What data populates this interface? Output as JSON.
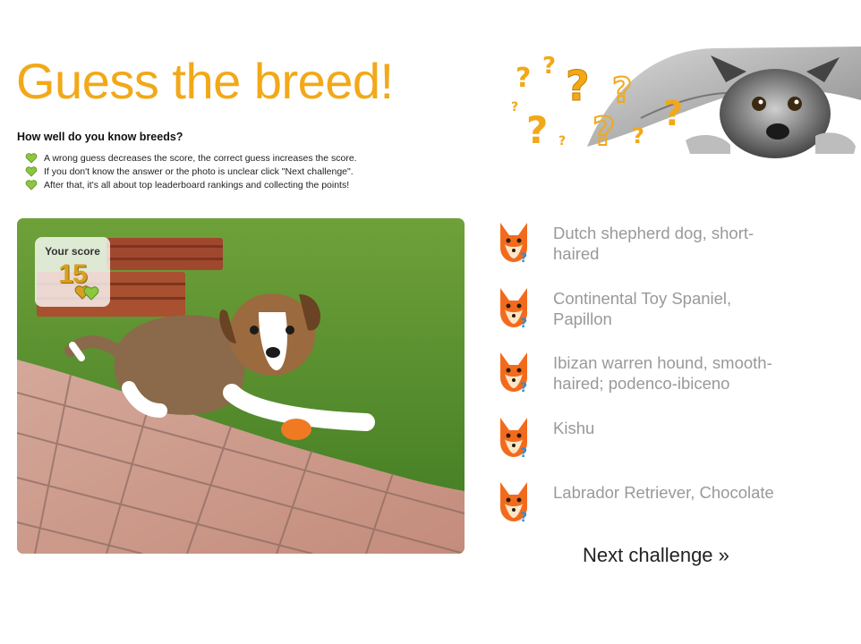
{
  "header": {
    "title": "Guess the breed!",
    "subtitle": "How well do you know breeds?",
    "rules": [
      "A wrong guess decreases the score, the correct guess increases the score.",
      "If you don't know the answer or the photo is unclear click \"Next challenge\".",
      "After that, it's all about top leaderboard rankings and collecting the points!"
    ]
  },
  "score": {
    "label": "Your score",
    "value": "15"
  },
  "answers": [
    {
      "label": "Dutch shepherd dog, short-haired"
    },
    {
      "label": "Continental Toy Spaniel, Papillon"
    },
    {
      "label": "Ibizan warren hound, smooth-haired; podenco-ibiceno"
    },
    {
      "label": "Kishu"
    },
    {
      "label": "Labrador Retriever, Chocolate"
    }
  ],
  "next_challenge": {
    "label": "Next challenge »"
  },
  "colors": {
    "accent": "#f2a818",
    "heart_green": "#8dc63f",
    "answer_text": "#999999",
    "fox_orange": "#f26b1d"
  },
  "icons": {
    "rule_bullet": "green-heart-icon",
    "answer_marker": "fox-question-icon"
  }
}
